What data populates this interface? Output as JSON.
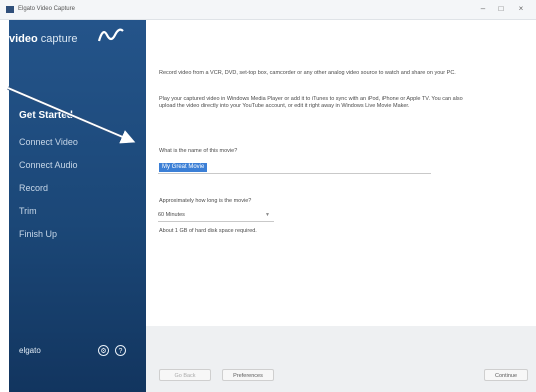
{
  "window": {
    "title": "Elgato Video Capture",
    "controls": {
      "minimize": "–",
      "maximize": "□",
      "close": "×"
    }
  },
  "sidebar": {
    "logo_bold": "video",
    "logo_thin": " capture",
    "logo_icon": "wave-logo-icon",
    "items": [
      {
        "label": "Get Started",
        "active": true
      },
      {
        "label": "Connect Video",
        "active": false
      },
      {
        "label": "Connect Audio",
        "active": false
      },
      {
        "label": "Record",
        "active": false
      },
      {
        "label": "Trim",
        "active": false
      },
      {
        "label": "Finish Up",
        "active": false
      }
    ],
    "brand": "elgato",
    "settings_icon": "gear-icon",
    "help_icon": "help-icon"
  },
  "main": {
    "intro1": "Record video from a VCR, DVD, set-top box, camcorder or any other analog video source to watch and share on your PC.",
    "intro2": "Play your captured video in Windows Media Player or add it to iTunes to sync with an iPod, iPhone or Apple TV. You can also upload the video directly into your YouTube account, or edit it right away in Windows Live Movie Maker.",
    "name_label": "What is the name of this movie?",
    "name_value": "My Great Movie",
    "duration_label": "Approximately how long is the movie?",
    "duration_value": "60 Minutes",
    "space_note": "About 1 GB of hard disk space required."
  },
  "footer": {
    "back": "Go Back",
    "preferences": "Preferences",
    "continue": "Continue"
  },
  "colors": {
    "sidebar": "#1f4d80",
    "selection": "#3b7fd6",
    "annotation_arrow": "#2b4f7c"
  }
}
